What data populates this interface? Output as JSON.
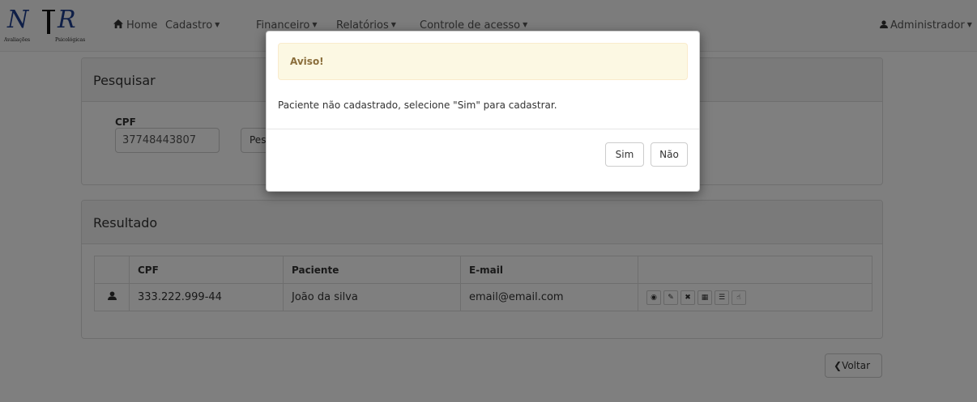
{
  "brand": {
    "mark": "NIR",
    "left_text": "Avaliações",
    "right_text": "Psicológicas"
  },
  "nav": {
    "home": "Home",
    "items": [
      "Cadastro",
      "Financeiro",
      "Relatórios",
      "Controle de acesso"
    ],
    "user": "Administrador"
  },
  "search_panel": {
    "title": "Pesquisar",
    "cpf_label": "CPF",
    "cpf_value": "37748443807",
    "button_label": "Pesquisar"
  },
  "results_panel": {
    "title": "Resultado",
    "columns": [
      "CPF",
      "Paciente",
      "E-mail"
    ],
    "rows": [
      {
        "cpf": "333.222.999-44",
        "paciente": "João da silva",
        "email": "email@email.com"
      }
    ],
    "actions": [
      "view-icon",
      "edit-icon",
      "delete-icon",
      "calendar-icon",
      "list-icon",
      "thumbs-up-icon"
    ]
  },
  "back_button": "Voltar",
  "modal": {
    "alert_title": "Aviso!",
    "message": "Paciente não cadastrado, selecione \"Sim\" para cadastrar.",
    "yes_label": "Sim",
    "no_label": "Não"
  },
  "colors": {
    "navbar_bg": "#f8f8f8",
    "alert_bg": "#fcf8e3",
    "alert_text": "#8a6d3b",
    "logo_blue": "#1f3f8f"
  }
}
